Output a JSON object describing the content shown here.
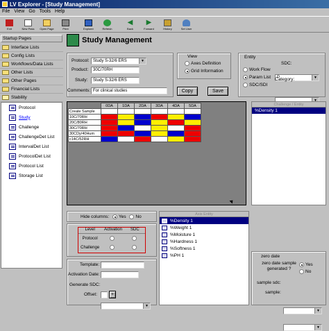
{
  "window": {
    "title": "LV Explorer - [Study Management]"
  },
  "menu": [
    "File",
    "View",
    "Go",
    "Tools",
    "Help"
  ],
  "toolbar": [
    {
      "label": "Exit",
      "icon": "exit-icon"
    },
    {
      "label": "New Pass",
      "icon": "new-icon"
    },
    {
      "label": "Open Page",
      "icon": "open-icon"
    },
    {
      "label": "Print",
      "icon": "print-icon"
    },
    {
      "label": "Explorer",
      "icon": "explorer-icon"
    },
    {
      "label": "Refresh",
      "icon": "refresh-icon"
    },
    {
      "label": "Back",
      "icon": "back-arrow-icon"
    },
    {
      "label": "Forward",
      "icon": "forward-arrow-icon"
    },
    {
      "label": "History",
      "icon": "history-icon"
    },
    {
      "label": "Set User",
      "icon": "user-icon"
    }
  ],
  "sidebar": {
    "header": "Startup Pages",
    "items": [
      "Interface Lists",
      "Config Lists",
      "Workflows/Data Lists",
      "Other Lists",
      "Other Pages",
      "Financial Lists"
    ],
    "stability_label": "Stability",
    "stability_items": [
      "Protocol",
      "Study",
      "Challenge",
      "ChallengeDet List",
      "IntervalDet List",
      "ProtocolDet List",
      "Protocol List",
      "Storage List"
    ]
  },
  "page": {
    "title": "Study Management"
  },
  "form": {
    "protocol_label": "Protocol:",
    "protocol_value": "Study S-32/6 ERS",
    "product_label": "Product:",
    "product_value": "30C/70RH",
    "study_label": "Study:",
    "study_value": "Study S-32/6 ERS",
    "comments_label": "Comments:",
    "comments_value": "For clinical studies",
    "copy_label": "Copy",
    "save_label": "Save"
  },
  "view": {
    "label": "View",
    "opt1": "Axes Definition",
    "opt2": "Grid Information"
  },
  "entity": {
    "label": "Entity",
    "opt1": "Work Flow",
    "opt2": "Param List",
    "opt3": "SDC/SDI",
    "sdc_label": "SDC:",
    "sdc_value": "P",
    "category_label": "Category:"
  },
  "matrix": {
    "columns": [
      "0DA",
      "1DA",
      "2DA",
      "3DA",
      "4DA",
      "5DA"
    ],
    "rows": [
      {
        "label": "Create Sample",
        "cells": [
          "#ffffff",
          "#ffffff",
          "#ffffff",
          "#ffffff",
          "#ffffff",
          "#ffffff"
        ]
      },
      {
        "label": "10C/70RH",
        "cells": [
          "#ee0000",
          "#ffee00",
          "#0000cc",
          "#ee0000",
          "#ffee00",
          "#0000cc"
        ]
      },
      {
        "label": "20C/80RH",
        "cells": [
          "#ee0000",
          "#ffee00",
          "#0000cc",
          "#ffee00",
          "#ee0000",
          "#ffee00"
        ]
      },
      {
        "label": "30C/70RH",
        "cells": [
          "#ee0000",
          "#0000cc",
          "#ffffff",
          "#ffee00",
          "#ffffff",
          "#ee0000"
        ]
      },
      {
        "label": "30CDy/40Hum",
        "cells": [
          "#ee0000",
          "#ee0000",
          "#0000cc",
          "#ffee00",
          "#0000cc",
          "#ee0000"
        ]
      },
      {
        "label": "c14C/52RH",
        "cells": [
          "#0000cc",
          "#ffffff",
          "#ee0000",
          "#ffffff",
          "#ffee00",
          "#ee0000"
        ]
      }
    ]
  },
  "challenge_panel": {
    "header": "Challenge / Entity",
    "selected": "%Density 1"
  },
  "hide_columns": {
    "label": "Hide columns:",
    "yes": "Yes",
    "no": "No"
  },
  "level_table": {
    "level": "Level",
    "activation": "Activation",
    "sdc": "SDC",
    "rows": [
      "Protocol",
      "Challenge"
    ]
  },
  "axis_entity": {
    "header": "Axis Entity",
    "items": [
      "%Density 1",
      "%Weight 1",
      "%Moisture 1",
      "%Hardness 1",
      "%Softness 1",
      "%PH 1"
    ]
  },
  "bottom_form": {
    "template_label": "Template:",
    "activation_label": "Activation Date:",
    "generate_label": "Generate SDC:",
    "offset_label": "Offset:",
    "offset_value": "+"
  },
  "zero_date": {
    "label": "zero date",
    "question": "zero date sample generated ?",
    "yes": "Yes",
    "no": "No",
    "sample_sdc_label": "sample sdc:",
    "sample_label": "sample:"
  }
}
